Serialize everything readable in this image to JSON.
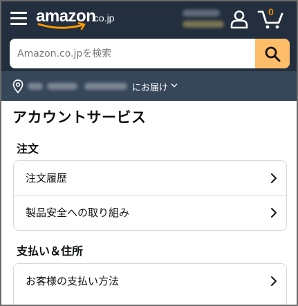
{
  "header": {
    "logo_word": "amazon",
    "logo_tld": ".co.jp",
    "cart_count": "0",
    "icons": {
      "menu": "hamburger-menu-icon",
      "user": "user-icon",
      "cart": "cart-icon"
    },
    "colors": {
      "bg": "#232f3e",
      "smile": "#ff9900",
      "cart_count": "#f08804"
    }
  },
  "search": {
    "placeholder": "Amazon.co.jpを検索",
    "value": "",
    "button_color": "#febd69"
  },
  "address_bar": {
    "deliver_label": "にお届け",
    "bg": "#37475a"
  },
  "page": {
    "title": "アカウントサービス",
    "sections": [
      {
        "title": "注文",
        "items": [
          {
            "label": "注文履歴"
          },
          {
            "label": "製品安全への取り組み"
          }
        ]
      },
      {
        "title": "支払い＆住所",
        "items": [
          {
            "label": "お客様の支払い方法"
          }
        ]
      }
    ]
  }
}
